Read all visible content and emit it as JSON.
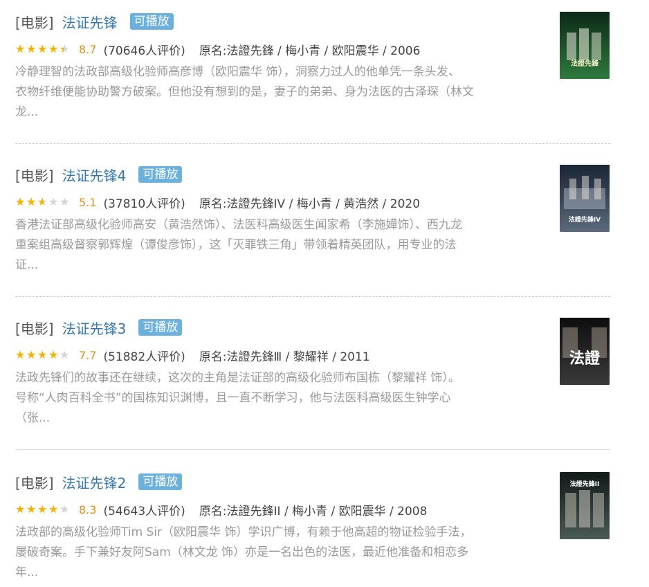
{
  "results": [
    {
      "category": "[电影]",
      "title": "法证先锋",
      "playable": "可播放",
      "rating": 8.7,
      "score": "8.7",
      "votes": "(70646人评价)",
      "subtitle": "原名:法證先鋒 / 梅小青 / 欧阳震华 / 2006",
      "desc_lines": [
        "冷静理智的法政部高级化验师高彦博（欧阳震华 饰），洞察力过人的他单凭一条头发、",
        "衣物纤维便能协助警方破案。但他没有想到的是，妻子的弟弟、身为法医的古泽琛（林文",
        "龙..."
      ],
      "poster_text": "法證先鋒",
      "poster_colors": [
        "#0c2a16",
        "#2f7a3e"
      ]
    },
    {
      "category": "[电影]",
      "title": "法证先锋4",
      "playable": "可播放",
      "rating": 5.1,
      "score": "5.1",
      "votes": "(37810人评价)",
      "subtitle": "原名:法證先鋒IV / 梅小青 / 黄浩然 / 2020",
      "desc_lines": [
        "香港法证部高级化验师高安（黄浩然饰）、法医科高级医生闻家希（李施嬅饰）、西九龙",
        "重案组高级督察郭辉煌（谭俊彦饰），这「灭罪铁三角」带领着精英团队，用专业的法",
        "证..."
      ],
      "poster_text": "法證先鋒IV",
      "poster_colors": [
        "#1a2535",
        "#5b6a7d"
      ]
    },
    {
      "category": "[电影]",
      "title": "法证先锋3",
      "playable": "可播放",
      "rating": 7.7,
      "score": "7.7",
      "votes": "(51882人评价)",
      "subtitle": "原名:法證先鋒Ⅲ / 黎耀祥 / 2011",
      "desc_lines": [
        "法政先锋们的故事还在继续，这次的主角是法证部的高级化验师布国栋（黎耀祥 饰）。",
        "号称“人肉百科全书”的国栋知识渊博，且一直不断学习，他与法医科高级医生钟学心",
        "（张..."
      ],
      "poster_text": "法證",
      "poster_colors": [
        "#0e0e0e",
        "#3a3a3a"
      ]
    },
    {
      "category": "[电影]",
      "title": "法证先锋2",
      "playable": "可播放",
      "rating": 8.3,
      "score": "8.3",
      "votes": "(54643人评价)",
      "subtitle": "原名:法證先鋒II / 梅小青 / 欧阳震华 / 2008",
      "desc_lines": [
        "法政部的高级化验师Tim Sir（欧阳震华 饰）学识广博，有赖于他高超的物证检验手法，",
        "屡破奇案。手下兼好友阿Sam（林文龙 饰）亦是一名出色的法医，最近他准备和相恋多",
        "年..."
      ],
      "poster_text": "法證先鋒II",
      "poster_colors": [
        "#121a1a",
        "#4a5a55"
      ]
    }
  ]
}
